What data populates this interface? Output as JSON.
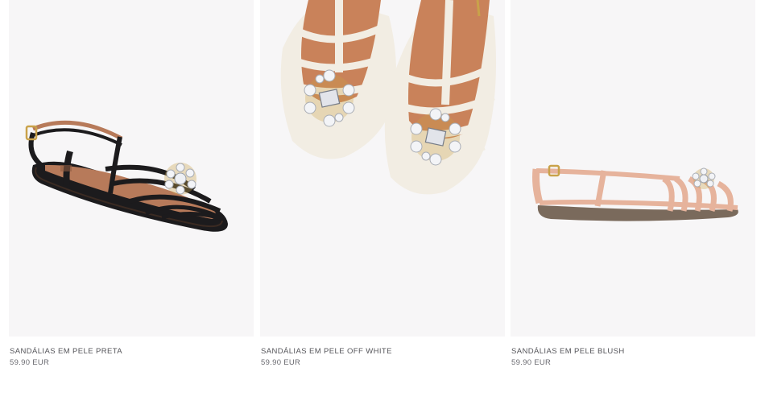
{
  "products": [
    {
      "name": "SANDÁLIAS EM PELE PRETA",
      "price": "59.90 EUR",
      "image_desc": "black-flat-sandal-jeweled-brooch"
    },
    {
      "name": "SANDÁLIAS EM PELE OFF WHITE",
      "price": "59.90 EUR",
      "image_desc": "off-white-sandals-jeweled-brooch"
    },
    {
      "name": "SANDÁLIAS EM PELE BLUSH",
      "price": "59.90 EUR",
      "image_desc": "blush-flat-sandal-jeweled-brooch"
    }
  ],
  "colors": {
    "image_bg": "#f7f6f7",
    "text": "#55555a",
    "black_leather": "#1c1b1d",
    "tan_lining": "#b77a5a",
    "off_white": "#f2ede3",
    "blush": "#e6b39c",
    "gold": "#c9a24a"
  }
}
